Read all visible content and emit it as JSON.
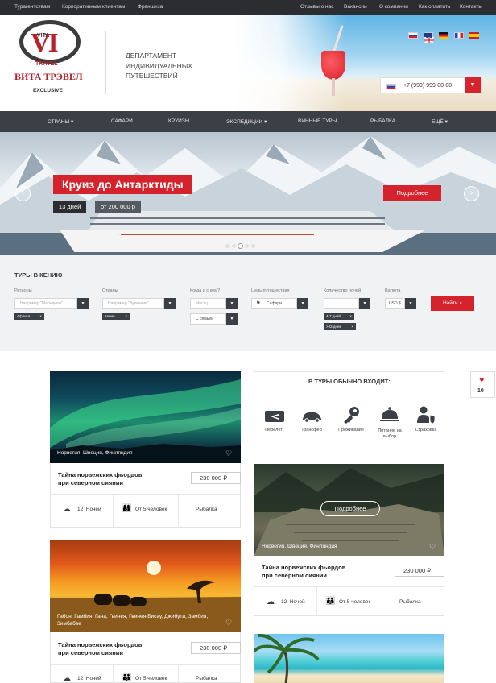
{
  "topbar": {
    "left": [
      "Турагентствам",
      "Корпоративным клиентам",
      "Франшиза"
    ],
    "right": [
      "Отзывы о нас",
      "Вакансии",
      "О компании",
      "Как оплатить",
      "Контакты"
    ]
  },
  "logo": {
    "vita": "VITA",
    "vi": "VI",
    "travel": "TRAVEL",
    "name": "ВИТА ТРЭВЕЛ",
    "exclusive": "EXCLUSIVE"
  },
  "tagline": [
    "ДЕПАРТАМЕНТ",
    "ИНДИВИДУАЛЬНЫХ",
    "ПУТЕШЕСТВИЙ"
  ],
  "languages": [
    "ru",
    "en",
    "de",
    "fr",
    "es"
  ],
  "phone": {
    "number": "+7 (999) 999-00-00"
  },
  "nav": [
    "СТРАНЫ ▾",
    "САФАРИ",
    "КРУИЗЫ",
    "ЭКСПЕДИЦИИ ▾",
    "ВИННЫЕ ТУРЫ",
    "РЫБАЛКА",
    "ЕЩЁ ▾"
  ],
  "banner": {
    "title": "Круиз до Антарктиды",
    "days": "13 дней",
    "price": "от 200 000 р",
    "button": "Подробнее",
    "prev": "‹",
    "next": "›",
    "slides": 5,
    "active_slide": 2
  },
  "search": {
    "title": "ТУРЫ В КЕНИЮ",
    "regions": {
      "label": "Регионы",
      "placeholder": "Например \"Мальдивы\"",
      "tags": [
        "Африка"
      ]
    },
    "countries": {
      "label": "Страны",
      "placeholder": "Например \"Вулкании\"",
      "tags": [
        "Кения"
      ]
    },
    "when": {
      "label": "Когда и с кем?",
      "month": "Месяц",
      "with": "С семьей"
    },
    "goal": {
      "label": "Цель путешествия",
      "value": "Сафари"
    },
    "nights": {
      "label": "Количество ночей",
      "tags": [
        "4-7 дней",
        ">22 дней"
      ]
    },
    "currency": {
      "label": "Валюта",
      "value": "USD $"
    },
    "find_button": "Найти"
  },
  "includes": {
    "title": "В ТУРЫ ОБЫЧНО ВХОДИТ:",
    "items": [
      "Перелет",
      "Трансфер",
      "Проживание",
      "Питание на выбор",
      "Страховка"
    ]
  },
  "favorites": {
    "count": "10"
  },
  "tours": [
    {
      "location": "Норвегия, Швеция, Финляндия",
      "title_line1": "Тайна норвежских фьордов",
      "title_line2": "при северном сиянии",
      "price": "230 000 ₽",
      "nights": "12",
      "nights_label": "Ночей",
      "people": "От 5 человек",
      "activity": "Рыбалка"
    },
    {
      "location": "Норвегия, Швеция, Финляндия",
      "title_line1": "Тайна норвежских фьордов",
      "title_line2": "при северном сиянии",
      "price": "230 000 ₽",
      "nights": "12",
      "nights_label": "Ночей",
      "people": "От 5 человек",
      "activity": "Рыбалка",
      "more": "Подробнее"
    },
    {
      "location": "Габон, Гамбия, Гана, Гвинея, Гвинея-Бисау, Джибути, Замбия, Зимбабве",
      "title_line1": "Тайна норвежских фьордов",
      "title_line2": "при северном сиянии",
      "price": "230 000 ₽",
      "nights": "12",
      "nights_label": "Ночей",
      "people": "От 5 человек",
      "activity": "Рыбалка"
    }
  ]
}
